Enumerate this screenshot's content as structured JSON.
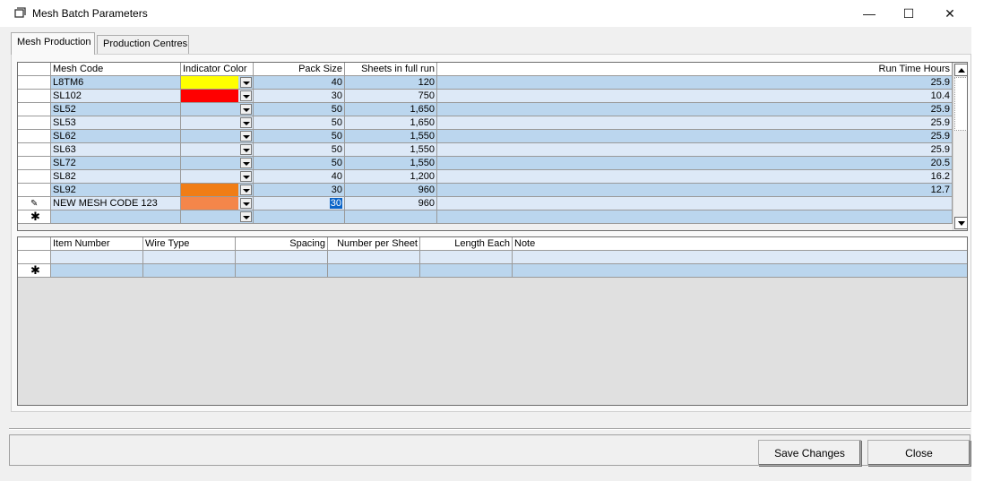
{
  "window": {
    "title": "Mesh Batch Parameters",
    "min_glyph": "—",
    "max_glyph": "☐",
    "close_glyph": "✕"
  },
  "tabs": [
    {
      "label": "Mesh Production",
      "active": true
    },
    {
      "label": "Production Centres",
      "active": false
    }
  ],
  "mesh_grid": {
    "columns": [
      "Mesh Code",
      "Indicator Color",
      "Pack Size",
      "Sheets in full run",
      "Run Time Hours"
    ],
    "rows": [
      {
        "code": "L8TM6",
        "color": "#ffff00",
        "pack": "40",
        "sheets": "120",
        "hours": "25.9"
      },
      {
        "code": "SL102",
        "color": "#ff0000",
        "pack": "30",
        "sheets": "750",
        "hours": "10.4"
      },
      {
        "code": "SL52",
        "color": "",
        "pack": "50",
        "sheets": "1,650",
        "hours": "25.9"
      },
      {
        "code": "SL53",
        "color": "",
        "pack": "50",
        "sheets": "1,650",
        "hours": "25.9"
      },
      {
        "code": "SL62",
        "color": "",
        "pack": "50",
        "sheets": "1,550",
        "hours": "25.9"
      },
      {
        "code": "SL63",
        "color": "",
        "pack": "50",
        "sheets": "1,550",
        "hours": "25.9"
      },
      {
        "code": "SL72",
        "color": "",
        "pack": "50",
        "sheets": "1,550",
        "hours": "20.5"
      },
      {
        "code": "SL82",
        "color": "",
        "pack": "40",
        "sheets": "1,200",
        "hours": "16.2"
      },
      {
        "code": "SL92",
        "color": "#f07d16",
        "pack": "30",
        "sheets": "960",
        "hours": "12.7"
      },
      {
        "code": "NEW MESH CODE 123",
        "color": "#f4864a",
        "pack": "30",
        "sheets": "960",
        "hours": ""
      }
    ],
    "editing_row_glyph": "✎",
    "new_row_glyph": "✱"
  },
  "item_grid": {
    "columns": [
      "Item Number",
      "Wire Type",
      "Spacing",
      "Number per Sheet",
      "Length Each",
      "Note"
    ],
    "new_row_glyph": "✱"
  },
  "buttons": {
    "save": "Save Changes",
    "close": "Close"
  }
}
